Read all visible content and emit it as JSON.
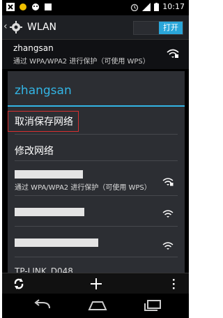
{
  "status_bar": {
    "time": "10:17"
  },
  "action_bar": {
    "title": "WLAN",
    "toggle_label": "打开"
  },
  "network_top": {
    "ssid": "zhangsan",
    "security": "通过 WPA/WPA2 进行保护（可使用 WPS）"
  },
  "dialog": {
    "title": "zhangsan",
    "options": [
      "取消保存网络",
      "修改网络"
    ],
    "list": [
      {
        "security": "通过 WPA/WPA2 进行保护（可使用 WPS）"
      },
      {
        "security": ""
      },
      {
        "security": ""
      }
    ],
    "partial_row_text": "TP-LINK_D048"
  },
  "icons": [
    "back-chevron-icon",
    "settings-gear-icon",
    "wifi-lock-icon",
    "wifi-icon",
    "refresh-icon",
    "add-icon",
    "overflow-menu-icon",
    "nav-back-icon",
    "nav-home-icon",
    "nav-recents-icon"
  ]
}
